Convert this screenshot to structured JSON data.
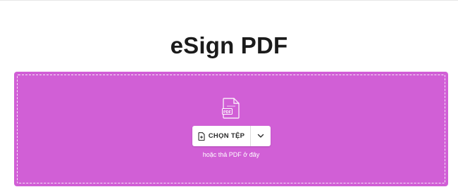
{
  "page": {
    "title": "eSign PDF"
  },
  "dropzone": {
    "file_icon_label": "PDF",
    "choose_button_label": "CHỌN TỆP",
    "hint_text": "hoặc thả PDF ở đây",
    "background_color": "#d15fd6"
  },
  "icons": {
    "file": "pdf-file-icon",
    "add_file": "add-file-icon",
    "dropdown": "chevron-down-icon"
  }
}
